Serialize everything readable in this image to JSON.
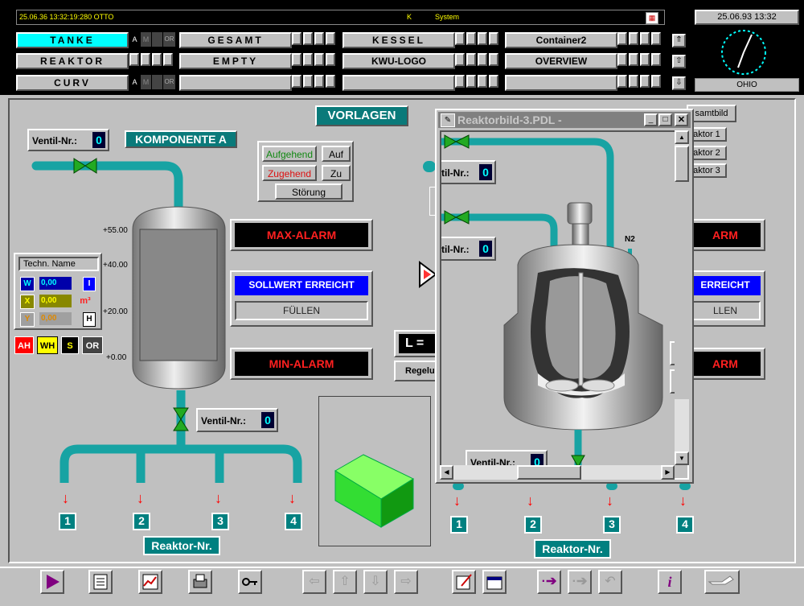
{
  "header": {
    "status_left": "25.06.36  13:32:19:280  OTTO",
    "status_k": "K",
    "status_system": "System",
    "date_time": "25.06.93  13:32",
    "clock_label": "OHIO"
  },
  "nav": {
    "row1": [
      "TANKE",
      "GESAMT",
      "KESSEL",
      "Container2"
    ],
    "row2": [
      "REAKTOR",
      "EMPTY",
      "KWU-LOGO",
      "OVERVIEW"
    ],
    "row3": [
      "CURV",
      "",
      "",
      ""
    ],
    "flags": {
      "a": "A",
      "m": "M",
      "or": "OR"
    }
  },
  "main": {
    "vorlagen": "VORLAGEN",
    "komponente": "KOMPONENTE A",
    "ventil_label": "Ventil-Nr.:",
    "ventil_value": "0",
    "aufgehend": "Aufgehend",
    "auf": "Auf",
    "zugehend": "Zugehend",
    "zu": "Zu",
    "stoerung": "Störung",
    "scale": [
      "+55.00",
      "+40.00",
      "+20.00",
      "+0.00"
    ],
    "max_alarm": "MAX-ALARM",
    "min_alarm": "MIN-ALARM",
    "sollwert": "SOLLWERT ERREICHT",
    "fuellen": "FÜLLEN",
    "techn_name": "Techn. Name",
    "w_label": "W",
    "w_value": "0,00",
    "x_label": "X",
    "x_value": "0,00",
    "y_label": "Y",
    "y_value": "0,00",
    "i_label": "I",
    "m3_label": "m³",
    "h_label": "H",
    "ah": "AH",
    "wh": "WH",
    "s": "S",
    "or": "OR",
    "l_label": "L =",
    "regelu": "Regelu",
    "reaktor_nr": "Reaktor-Nr.",
    "reactor_numbers": [
      "1",
      "2",
      "3",
      "4"
    ]
  },
  "right_partial": {
    "items": [
      "samtbild",
      "aktor 1",
      "aktor 2",
      "aktor 3"
    ],
    "alarm1": "ARM",
    "erreicht": "ERREICHT",
    "llen": "LLEN",
    "alarm2": "ARM"
  },
  "popup": {
    "title": "Reaktorbild-3.PDL -",
    "ventil_label_cut": "til-Nr.:",
    "ventil_label": "Ventil-Nr.:",
    "n2": "N2"
  },
  "colors": {
    "teal": "#0a7a7a",
    "alarm_red": "#ff2020",
    "blue": "#0000ff",
    "pipe": "#17a3a3"
  }
}
